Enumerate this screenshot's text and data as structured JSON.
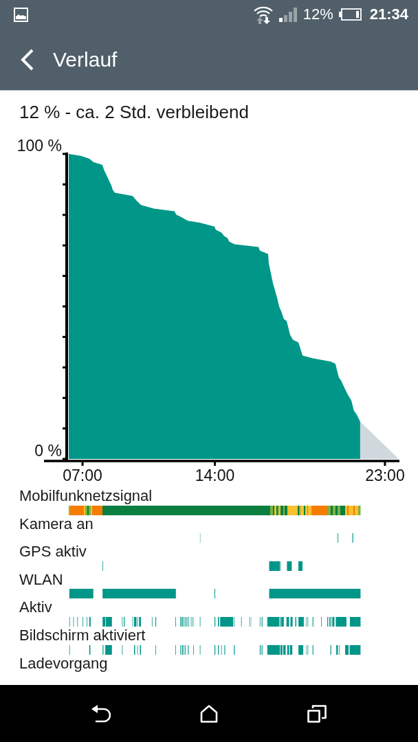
{
  "status_bar": {
    "battery_text": "12%",
    "time": "21:34"
  },
  "header": {
    "title": "Verlauf"
  },
  "summary": "12 % - ca. 2 Std. verbleibend",
  "chart": {
    "chart_data": {
      "type": "area",
      "x": [
        6.27,
        6.93,
        7.36,
        7.58,
        8.05,
        8.13,
        8.27,
        8.42,
        8.53,
        8.6,
        8.71,
        9.65,
        9.84,
        10.09,
        10.75,
        11.87,
        11.95,
        12.24,
        12.56,
        13.22,
        13.98,
        14.05,
        14.35,
        14.49,
        14.67,
        14.75,
        15.04,
        16.31,
        16.38,
        16.82,
        16.85,
        17.07,
        17.29,
        17.4,
        17.51,
        17.65,
        17.8,
        17.98,
        18.13,
        18.42,
        18.49,
        18.64,
        19.18,
        20.13,
        20.38,
        20.45,
        20.56,
        20.67,
        20.82,
        21.04,
        21.22,
        21.36,
        21.51,
        21.69,
        23.73
      ],
      "series": [
        {
          "color": "#009688",
          "values": [
            100,
            99.3,
            98.4,
            97.3,
            96.4,
            94.8,
            93,
            91,
            89.6,
            88.2,
            87.3,
            86.2,
            84.8,
            83.3,
            82.1,
            81.2,
            80.1,
            79.2,
            78.1,
            77.4,
            76.2,
            75.1,
            74.2,
            73.1,
            72.4,
            71.3,
            70.4,
            69.5,
            68.3,
            67.2,
            64.3,
            57.7,
            52.9,
            50,
            48.4,
            45.9,
            45.2,
            40.7,
            39.1,
            38.2,
            36.9,
            33.9,
            33,
            31.9,
            31.2,
            29.4,
            26.7,
            25.8,
            23.8,
            21,
            19.2,
            15.8,
            14.5,
            12.2,
            null
          ]
        },
        {
          "color": "#cfd8dc",
          "values": [
            null,
            null,
            null,
            null,
            null,
            null,
            null,
            null,
            null,
            null,
            null,
            null,
            null,
            null,
            null,
            null,
            null,
            null,
            null,
            null,
            null,
            null,
            null,
            null,
            null,
            null,
            null,
            null,
            null,
            null,
            null,
            null,
            null,
            null,
            null,
            null,
            null,
            null,
            null,
            null,
            null,
            null,
            null,
            null,
            null,
            null,
            null,
            null,
            null,
            null,
            null,
            null,
            null,
            12.2,
            0
          ]
        }
      ],
      "xlim": [
        6.27,
        23.73
      ],
      "ylim": [
        0,
        100
      ],
      "xticks": [
        {
          "value": 7,
          "label": "07:00"
        },
        {
          "value": 14,
          "label": "14:00"
        },
        {
          "value": 23,
          "label": "23:00"
        }
      ],
      "yticks": [
        {
          "value": 0,
          "label": "0 %"
        },
        {
          "value": 100,
          "label": "100 %"
        }
      ]
    }
  },
  "timelines": [
    {
      "label": "Mobilfunknetzsignal"
    },
    {
      "label": "Kamera an"
    },
    {
      "label": "GPS aktiv"
    },
    {
      "label": "WLAN"
    },
    {
      "label": "Aktiv"
    },
    {
      "label": "Bildschirm aktiviert"
    },
    {
      "label": "Ladevorgang"
    }
  ]
}
